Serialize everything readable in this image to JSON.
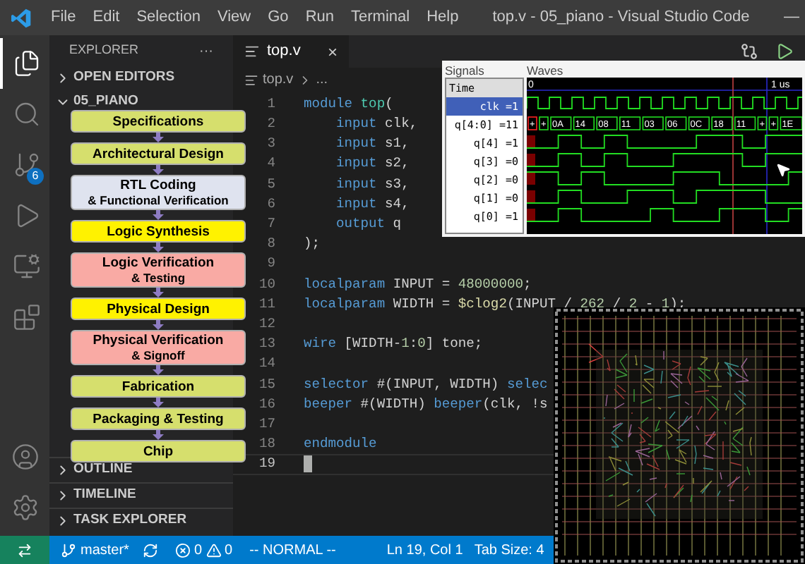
{
  "title_bar": {
    "menu": [
      "File",
      "Edit",
      "Selection",
      "View",
      "Go",
      "Run",
      "Terminal",
      "Help"
    ],
    "title": "top.v - 05_piano - Visual Studio Code",
    "minimize": "—"
  },
  "activity_bar": [
    {
      "kind": "files",
      "selected": true
    },
    {
      "kind": "search",
      "selected": false
    },
    {
      "kind": "source-control",
      "selected": false,
      "badge": "6"
    },
    {
      "kind": "run",
      "selected": false
    },
    {
      "kind": "remote",
      "selected": false
    },
    {
      "kind": "extensions",
      "selected": false
    }
  ],
  "activity_bottom": [
    {
      "kind": "account"
    },
    {
      "kind": "settings"
    }
  ],
  "sidebar": {
    "title": "EXPLORER",
    "more": "···",
    "sections_top": [
      {
        "label": "OPEN EDITORS",
        "expanded": false
      },
      {
        "label": "05_PIANO",
        "expanded": true
      }
    ],
    "sections_bottom": [
      {
        "label": "OUTLINE",
        "expanded": false
      },
      {
        "label": "TIMELINE",
        "expanded": false
      },
      {
        "label": "TASK EXPLORER",
        "expanded": false
      }
    ]
  },
  "tab": {
    "label": "top.v",
    "close": "×"
  },
  "breadcrumb": [
    "top.v",
    "..."
  ],
  "code": [
    {
      "n": "1",
      "cursor": false,
      "indent": false,
      "tokens": [
        {
          "kind": "keyword",
          "text": "module"
        },
        {
          "kind": "type",
          "text": " top"
        },
        {
          "kind": "plain",
          "text": "("
        }
      ]
    },
    {
      "n": "2",
      "cursor": false,
      "indent": true,
      "tokens": [
        {
          "kind": "keyword",
          "text": "input"
        },
        {
          "kind": "plain",
          "text": " clk,"
        }
      ]
    },
    {
      "n": "3",
      "cursor": false,
      "indent": true,
      "tokens": [
        {
          "kind": "keyword",
          "text": "input"
        },
        {
          "kind": "plain",
          "text": " s1,"
        }
      ]
    },
    {
      "n": "4",
      "cursor": false,
      "indent": true,
      "tokens": [
        {
          "kind": "keyword",
          "text": "input"
        },
        {
          "kind": "plain",
          "text": " s2,"
        }
      ]
    },
    {
      "n": "5",
      "cursor": false,
      "indent": true,
      "tokens": [
        {
          "kind": "keyword",
          "text": "input"
        },
        {
          "kind": "plain",
          "text": " s3,"
        }
      ]
    },
    {
      "n": "6",
      "cursor": false,
      "indent": true,
      "tokens": [
        {
          "kind": "keyword",
          "text": "input"
        },
        {
          "kind": "plain",
          "text": " s4,"
        }
      ]
    },
    {
      "n": "7",
      "cursor": false,
      "indent": true,
      "tokens": [
        {
          "kind": "keyword",
          "text": "output"
        },
        {
          "kind": "plain",
          "text": " q"
        }
      ]
    },
    {
      "n": "8",
      "cursor": false,
      "indent": false,
      "tokens": [
        {
          "kind": "plain",
          "text": ");"
        }
      ]
    },
    {
      "n": "9",
      "cursor": false
    },
    {
      "n": "10",
      "cursor": false,
      "indent": false,
      "tokens": [
        {
          "kind": "keyword",
          "text": "localparam"
        },
        {
          "kind": "plain",
          "text": " INPUT = "
        },
        {
          "kind": "number",
          "text": "48000000"
        },
        {
          "kind": "plain",
          "text": ";"
        }
      ]
    },
    {
      "n": "11",
      "cursor": false,
      "indent": false,
      "tokens": [
        {
          "kind": "keyword",
          "text": "localparam"
        },
        {
          "kind": "plain",
          "text": " WIDTH = "
        },
        {
          "kind": "func",
          "text": "$clog2"
        },
        {
          "kind": "plain",
          "text": "(INPUT / "
        },
        {
          "kind": "number",
          "text": "262"
        },
        {
          "kind": "plain",
          "text": " / "
        },
        {
          "kind": "number",
          "text": "2"
        },
        {
          "kind": "plain",
          "text": " - "
        },
        {
          "kind": "number",
          "text": "1"
        },
        {
          "kind": "plain",
          "text": ");"
        }
      ]
    },
    {
      "n": "12",
      "cursor": false
    },
    {
      "n": "13",
      "cursor": false,
      "indent": false,
      "tokens": [
        {
          "kind": "keyword",
          "text": "wire"
        },
        {
          "kind": "plain",
          "text": " [WIDTH-"
        },
        {
          "kind": "number",
          "text": "1"
        },
        {
          "kind": "plain",
          "text": ":"
        },
        {
          "kind": "number",
          "text": "0"
        },
        {
          "kind": "plain",
          "text": "] tone;"
        }
      ]
    },
    {
      "n": "14",
      "cursor": false
    },
    {
      "n": "15",
      "cursor": false,
      "indent": false,
      "tokens": [
        {
          "kind": "keyword",
          "text": "selector"
        },
        {
          "kind": "plain",
          "text": " #(INPUT, WIDTH) "
        },
        {
          "kind": "keyword",
          "text": "selec"
        }
      ]
    },
    {
      "n": "16",
      "cursor": false,
      "indent": false,
      "tokens": [
        {
          "kind": "keyword",
          "text": "beeper"
        },
        {
          "kind": "plain",
          "text": " #(WIDTH) "
        },
        {
          "kind": "keyword",
          "text": "beeper"
        },
        {
          "kind": "plain",
          "text": "(clk, !s"
        }
      ]
    },
    {
      "n": "17",
      "cursor": false
    },
    {
      "n": "18",
      "cursor": false,
      "indent": false,
      "tokens": [
        {
          "kind": "keyword",
          "text": "endmodule"
        }
      ]
    },
    {
      "n": "19",
      "cursor": true
    }
  ],
  "flowchart": [
    {
      "lines": [
        "Specifications"
      ],
      "color": "#d6df6d"
    },
    {
      "lines": [
        "Architectural Design"
      ],
      "color": "#d6df6d"
    },
    {
      "lines": [
        "RTL Coding",
        "& Functional Verification"
      ],
      "color": "#dfe3ef"
    },
    {
      "lines": [
        "Logic Synthesis"
      ],
      "color": "#fff200"
    },
    {
      "lines": [
        "Logic Verification",
        "& Testing"
      ],
      "color": "#f9aaa4"
    },
    {
      "lines": [
        "Physical Design"
      ],
      "color": "#fff200"
    },
    {
      "lines": [
        "Physical Verification",
        "&  Signoff"
      ],
      "color": "#f9aaa4"
    },
    {
      "lines": [
        "Fabrication"
      ],
      "color": "#d6df6d"
    },
    {
      "lines": [
        "Packaging & Testing"
      ],
      "color": "#d6df6d"
    },
    {
      "lines": [
        "Chip"
      ],
      "color": "#d6df6d"
    }
  ],
  "wave_viewer": {
    "signals_label": "Signals",
    "waves_label": "Waves",
    "signals": [
      {
        "label": "Time",
        "selected": false
      },
      {
        "label": "clk =1",
        "selected": true
      },
      {
        "label": "q[4:0] =11",
        "selected": false
      },
      {
        "label": "q[4] =1",
        "selected": false
      },
      {
        "label": "q[3] =0",
        "selected": false
      },
      {
        "label": "q[2] =0",
        "selected": false
      },
      {
        "label": "q[1] =0",
        "selected": false
      },
      {
        "label": "q[0] =1",
        "selected": false
      }
    ],
    "ruler": [
      "0",
      "1 us"
    ],
    "bus_values": [
      "+",
      "+",
      "0A",
      "14",
      "08",
      "11",
      "03",
      "06",
      "0C",
      "18",
      "11",
      "+",
      "+",
      "1E"
    ]
  },
  "status_bar": {
    "branch": "master*",
    "errors": "0",
    "warnings": "0",
    "mode": "-- NORMAL --",
    "position": "Ln 19, Col 1",
    "tab_size": "Tab Size: 4"
  }
}
